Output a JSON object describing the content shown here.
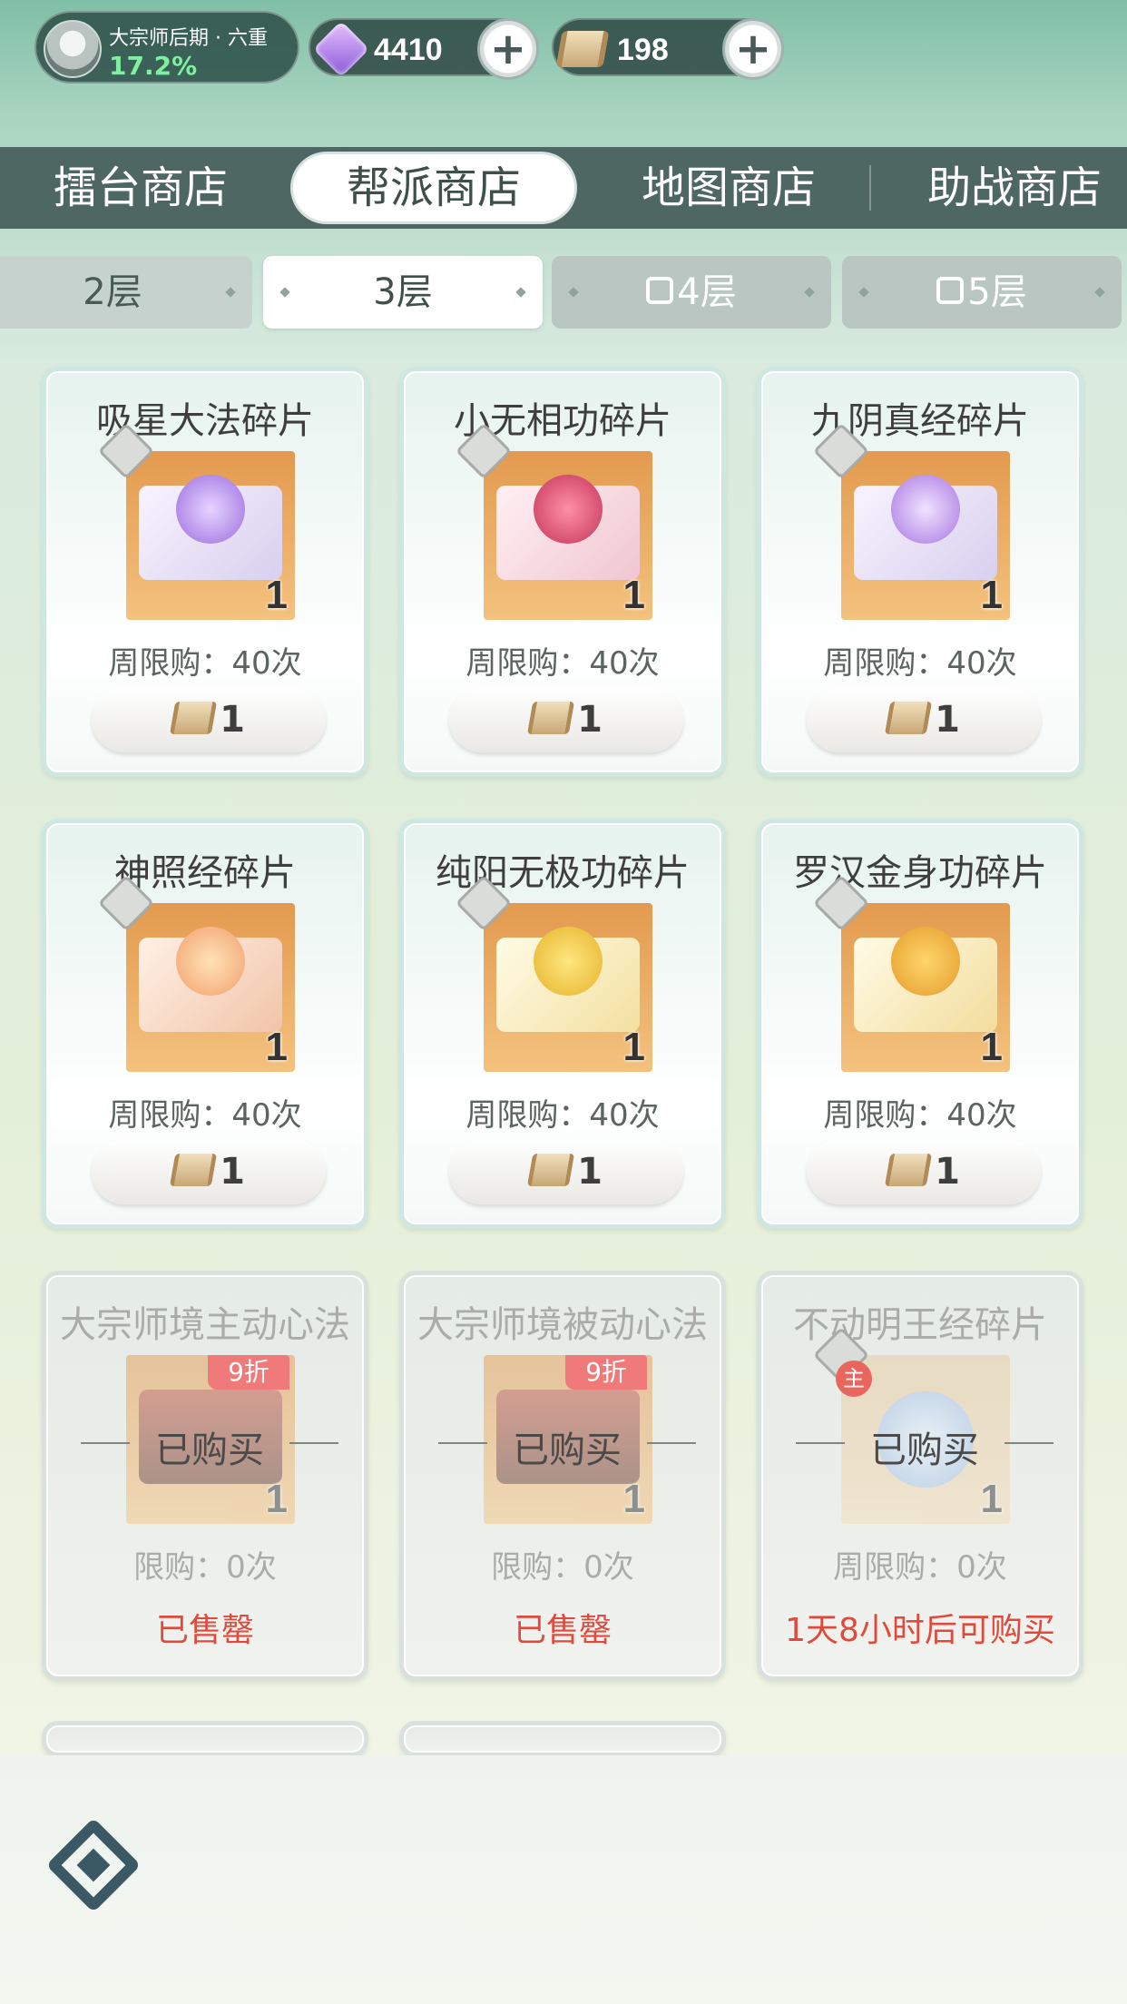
{
  "status": {
    "realm_name": "大宗师后期 · 六重",
    "realm_progress": "17.2%",
    "currencies": [
      {
        "icon": "gem-icon",
        "value": "4410",
        "plus": "+"
      },
      {
        "icon": "scroll-icon",
        "value": "198",
        "plus": "+"
      }
    ]
  },
  "shop_tabs": [
    "擂台商店",
    "帮派商店",
    "地图商店",
    "助战商店"
  ],
  "floors": [
    "2层",
    "3层",
    "4层",
    "5层"
  ],
  "cards": [
    {
      "title": "吸星大法碎片",
      "qty": "1",
      "limit": "周限购：40次",
      "price": "1",
      "color": "#9b6de0"
    },
    {
      "title": "小无相功碎片",
      "qty": "1",
      "limit": "周限购：40次",
      "price": "1",
      "color": "#c4345a"
    },
    {
      "title": "九阴真经碎片",
      "qty": "1",
      "limit": "周限购：40次",
      "price": "1",
      "color": "#a776e2"
    },
    {
      "title": "神照经碎片",
      "qty": "1",
      "limit": "周限购：40次",
      "price": "1",
      "color": "#f2a070"
    },
    {
      "title": "纯阳无极功碎片",
      "qty": "1",
      "limit": "周限购：40次",
      "price": "1",
      "color": "#e5b42b"
    },
    {
      "title": "罗汉金身功碎片",
      "qty": "1",
      "limit": "周限购：40次",
      "price": "1",
      "color": "#e49b2c"
    },
    {
      "title": "大宗师境主动心法",
      "qty": "1",
      "limit": "限购：0次",
      "discount": "9折",
      "bought": "已购买",
      "status": "已售罄"
    },
    {
      "title": "大宗师境被动心法",
      "qty": "1",
      "limit": "限购：0次",
      "discount": "9折",
      "bought": "已购买",
      "status": "已售罄"
    },
    {
      "title": "不动明王经碎片",
      "qty": "1",
      "limit": "周限购：0次",
      "badge": "主",
      "bought": "已购买",
      "status": "1天8小时后可购买"
    }
  ]
}
